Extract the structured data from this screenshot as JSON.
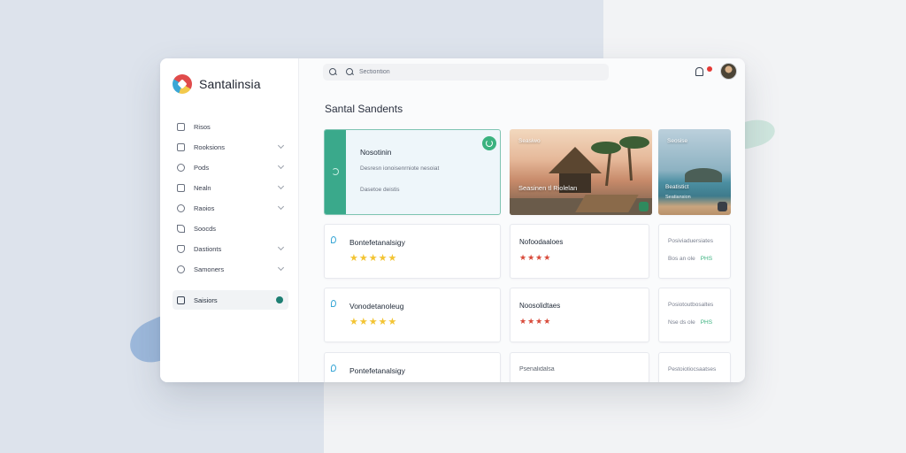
{
  "app": {
    "name": "Santalinsia",
    "logo_icon": "pinwheel-logo-icon"
  },
  "sidebar": {
    "items": [
      {
        "label": "Risos",
        "icon": "home-icon",
        "has_chevron": false
      },
      {
        "label": "Rooksions",
        "icon": "calendar-icon",
        "has_chevron": true
      },
      {
        "label": "Pods",
        "icon": "clock-icon",
        "has_chevron": true
      },
      {
        "label": "Nealn",
        "icon": "calendar-icon",
        "has_chevron": true
      },
      {
        "label": "Raoios",
        "icon": "clock-icon",
        "has_chevron": true
      },
      {
        "label": "Soocds",
        "icon": "pencil-icon",
        "has_chevron": false
      },
      {
        "label": "Dastionts",
        "icon": "shield-icon",
        "has_chevron": true
      },
      {
        "label": "Samoners",
        "icon": "settings-icon",
        "has_chevron": true
      }
    ],
    "active_item": {
      "label": "Saisiors",
      "icon": "folder-icon"
    }
  },
  "header": {
    "search_placeholder": "Sectiontion",
    "notification_icon": "bell-icon",
    "avatar_icon": "user-avatar"
  },
  "main": {
    "section_title": "Santal Sandents",
    "featured": {
      "title": "Nosotinin",
      "line1": "Desresn ionoisenrniote nesoiat",
      "line2": "Dasetoe deistis"
    },
    "photos": [
      {
        "caption": "Seasiwo",
        "subtitle": "Seasinen tl Riolelan"
      },
      {
        "caption": "Seosise",
        "subtitle": "Beatistict",
        "subtitle2": "Seatiansion"
      }
    ],
    "reviews": [
      {
        "title": "Bontefetanalsigy",
        "stars": "★★★★★"
      },
      {
        "title": "Vonodetanoleug",
        "stars": "★★★★★"
      },
      {
        "title": "Pontefetanalsigy",
        "stars": "★★★★★"
      }
    ],
    "places": [
      {
        "title": "Nofoodaaloes",
        "stars": "★★★★"
      },
      {
        "title": "Noosolidtaes",
        "stars": "★★★★"
      },
      {
        "title": "Psenalidalsa",
        "stars": ""
      }
    ],
    "side_cards": [
      {
        "title": "Posiviaduersiates",
        "text": "Bos an ole",
        "tag": "PHS"
      },
      {
        "title": "Posiotoutbosaltes",
        "text": "Nse ds ole",
        "tag": "PHS"
      },
      {
        "title": "Pestoiotiocsaatses",
        "text": "",
        "tag": ""
      }
    ]
  },
  "colors": {
    "accent_green": "#3aa98b",
    "badge_green": "#3ab27f",
    "star_yellow": "#f3c433",
    "star_red": "#d84a3a",
    "notification_red": "#e53935",
    "active_dot": "#1e7f73"
  }
}
